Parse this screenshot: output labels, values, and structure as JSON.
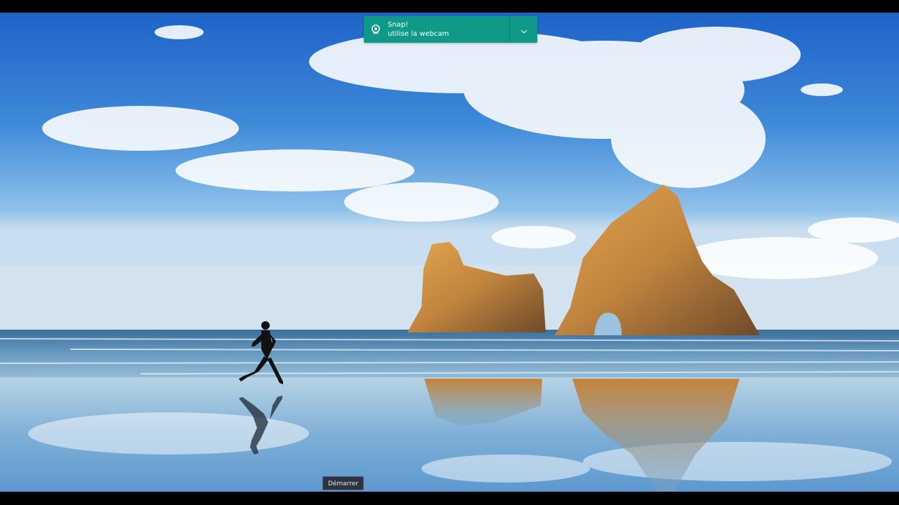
{
  "desktop": {
    "wallpaper": "beach-with-sea-rocks-and-runner"
  },
  "notification": {
    "app_icon": "webcam-icon",
    "title": "Snap!",
    "message": "utilise la webcam",
    "accent_color": "#0f9a87",
    "expand_icon": "chevron-down-icon"
  },
  "taskbar": {
    "start_tooltip": "Démarrer"
  }
}
